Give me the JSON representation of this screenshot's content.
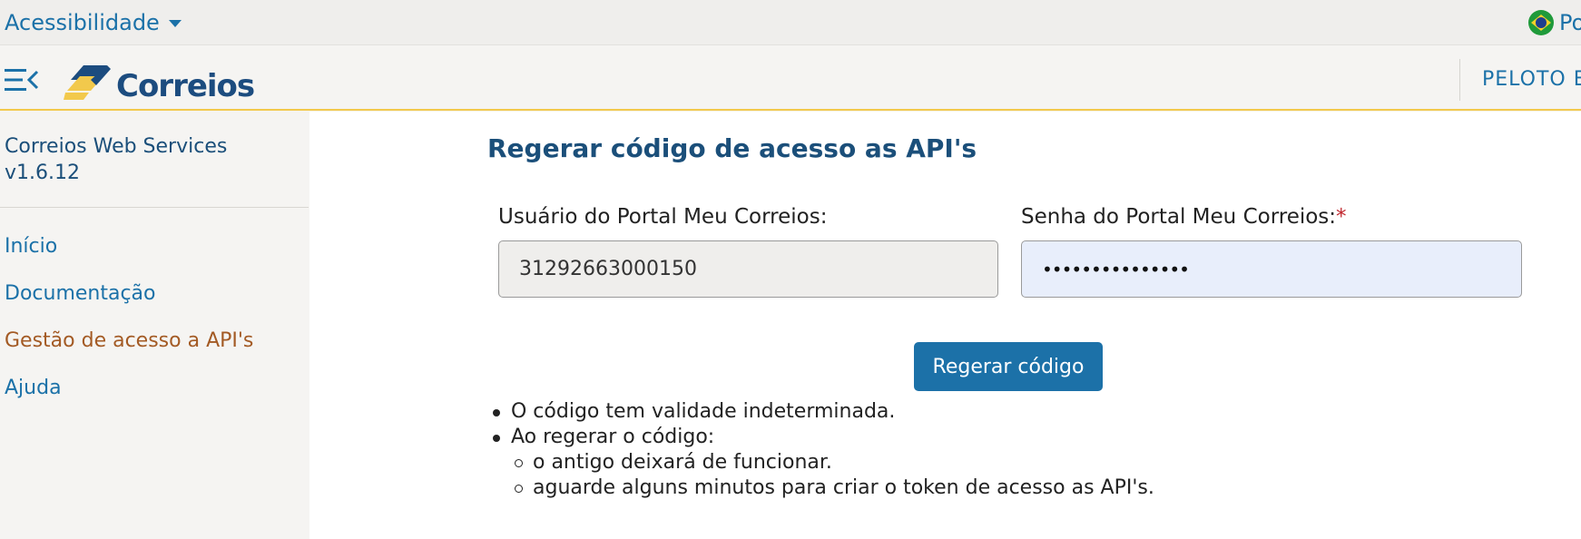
{
  "topbar": {
    "accessibility_label": "Acessibilidade",
    "language_label": "Po"
  },
  "header": {
    "logo_text": "Correios",
    "user_label": "PELOTO ES"
  },
  "sidebar": {
    "service_name": "Correios Web Services",
    "version": "v1.6.12",
    "items": [
      {
        "label": "Início"
      },
      {
        "label": "Documentação"
      },
      {
        "label": "Gestão de acesso a API's"
      },
      {
        "label": "Ajuda"
      }
    ]
  },
  "main": {
    "title": "Regerar código de acesso as API's",
    "user_field_label": "Usuário do Portal Meu Correios:",
    "user_field_value": "31292663000150",
    "password_field_label": "Senha do Portal Meu Correios:",
    "password_required_mark": "*",
    "password_field_value": "•••••••••••••••",
    "submit_label": "Regerar código",
    "notes": [
      "O código tem validade indeterminada.",
      "Ao regerar o código:"
    ],
    "sub_notes": [
      "o antigo deixará de funcionar.",
      "aguarde alguns minutos para criar o token de acesso as API's."
    ]
  },
  "colors": {
    "brand_blue": "#1c4c7f",
    "link_blue": "#1b71a8",
    "button_blue": "#1c71a8",
    "active_link": "#a35a24",
    "header_accent": "#f2c94c",
    "required": "#c0262d"
  },
  "icons": {
    "accessibility_caret": "chevron-down-icon",
    "language_flag": "brazil-flag-icon",
    "menu": "menu-collapse-icon",
    "logo": "correios-logo-icon"
  }
}
